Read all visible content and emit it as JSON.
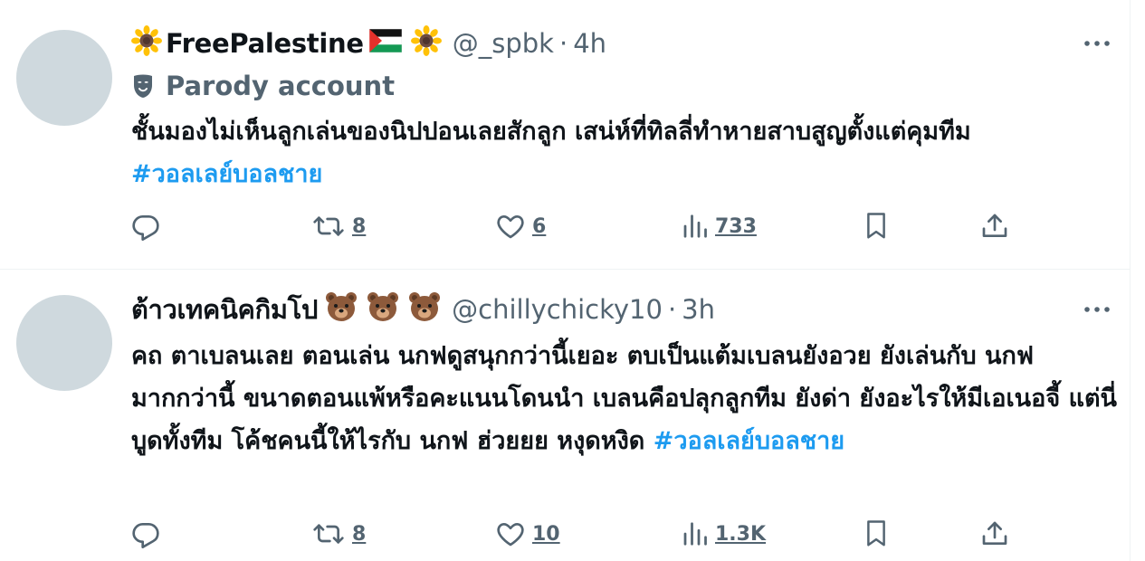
{
  "tweets": [
    {
      "display_name": "FreePalestine",
      "handle": "@_spbk",
      "separator": "·",
      "time": "4h",
      "parody_label": "Parody account",
      "body": "ชั้นมองไม่เห็นลูกเล่นของนิปปอนเลยสักลูก เสน่ห์ที่ทิลลี่ทำหายสาบสูญตั้งแต่คุมทีม ",
      "hashtag": "#วอลเลย์บอลชาย",
      "reposts": "8",
      "likes": "6",
      "views": "733"
    },
    {
      "display_name": "ต้าวเทคนิคกิมโป",
      "handle": "@chillychicky10",
      "separator": "·",
      "time": "3h",
      "body": "คถ ตาเบลนเลย ตอนเล่น นกฟดูสนุกกว่านี้เยอะ ตบเป็นแต้มเบลนยังอวย ยังเล่นกับ นกฟมากกว่านี้ ขนาดตอนแพ้หรือคะแนนโดนนำ เบลนคือปลุกลูกทีม ยังด่า ยังอะไรให้มีเอเนอจี้ แต่นี่บูดทั้งทีม โค้ชคนนี้ให้ไรกับ นกฟ ฮ่วยยย หงุดหงิด ",
      "hashtag": "#วอลเลย์บอลชาย",
      "reposts": "8",
      "likes": "10",
      "views": "1.3K"
    }
  ],
  "icons": {
    "more": "more-horizontal-icon",
    "reply": "reply-icon",
    "repost": "repost-icon",
    "like": "heart-icon",
    "views": "views-chart-icon",
    "bookmark": "bookmark-icon",
    "share": "share-icon",
    "parody": "mask-icon",
    "sunflower": "sunflower-emoji",
    "flag": "palestine-flag-emoji",
    "bear": "bear-emoji"
  },
  "colors": {
    "text": "#0f1419",
    "secondary": "#536471",
    "hashtag": "#1d9bf0",
    "avatar": "#cfd9de",
    "divider": "#eff3f4"
  }
}
